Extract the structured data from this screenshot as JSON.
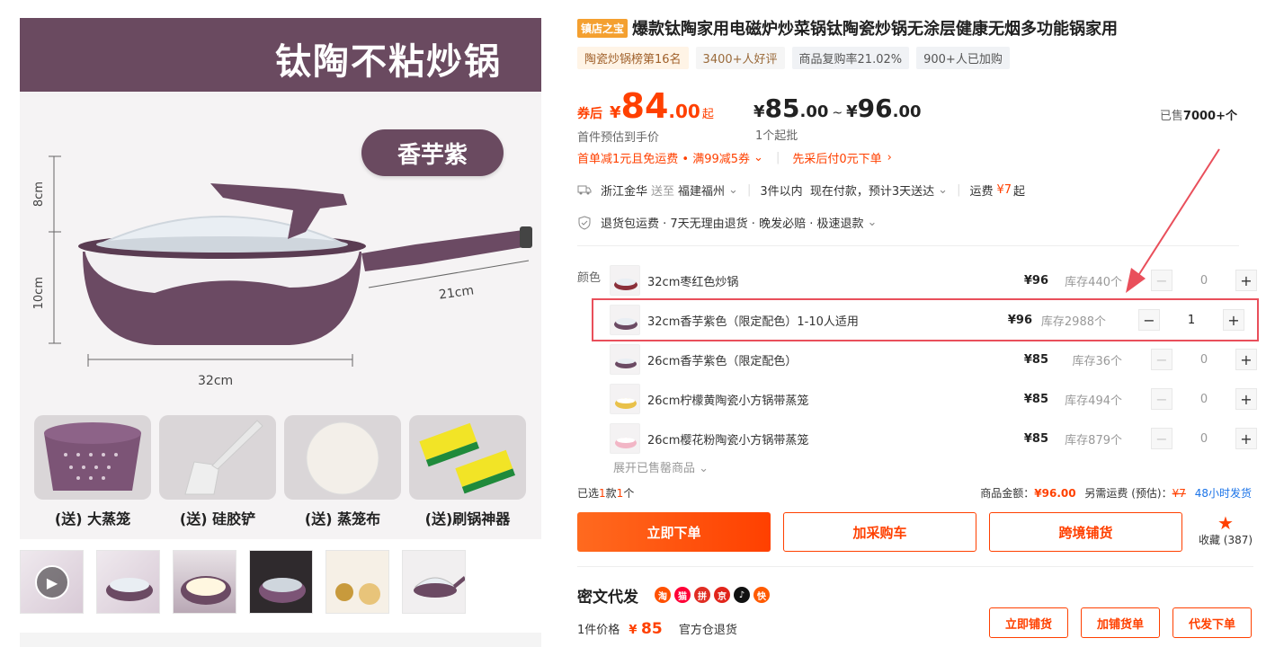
{
  "gallery": {
    "banner_title": "钛陶不粘炒锅",
    "color_pill": "香芋紫",
    "dims": {
      "height_top": "8cm",
      "height_bottom": "10cm",
      "handle": "21cm",
      "diameter": "32cm"
    },
    "accessories": [
      {
        "label": "(送) 大蒸笼",
        "icon": "steamer-basket-icon"
      },
      {
        "label": "(送) 硅胶铲",
        "icon": "spatula-icon"
      },
      {
        "label": "(送) 蒸笼布",
        "icon": "steamer-cloth-icon"
      },
      {
        "label": "(送)刷锅神器",
        "icon": "sponge-icon"
      }
    ],
    "thumb_count": 6
  },
  "product": {
    "store_badge": "镇店之宝",
    "title": "爆款钛陶家用电磁炉炒菜锅钛陶瓷炒锅无涂层健康无烟多功能锅家用",
    "tags": [
      "陶瓷炒锅榜第16名",
      "3400+人好评",
      "商品复购率21.02%",
      "900+人已加购"
    ]
  },
  "price": {
    "coupon_label": "券后",
    "currency": "¥",
    "main_int": "84",
    "main_dec": ".00",
    "main_suffix": "起",
    "main_sub": "首件预估到手价",
    "range_low_int": "85",
    "range_low_dec": ".00",
    "range_tilde": "~",
    "range_high_int": "96",
    "range_high_dec": ".00",
    "min_order": "1个起批",
    "sold_label": "已售",
    "sold_value": "7000+个"
  },
  "promo": {
    "first_order": "首单减1元且免运费 • 满99减5券",
    "pay_later": "先采后付0元下单"
  },
  "shipping": {
    "from": "浙江金华",
    "to_label": "送至",
    "to": "福建福州",
    "delivery": "3件以内  现在付款，预计3天送达",
    "fee_label": "运费",
    "fee_value": "¥7",
    "fee_suffix": "起"
  },
  "services": "退货包运费 · 7天无理由退货 · 晚发必赔 · 极速退款",
  "sku": {
    "color_label": "颜色",
    "items": [
      {
        "name": "32cm枣红色炒锅",
        "price": "¥96",
        "stock": "库存440个",
        "qty": "0"
      },
      {
        "name": "32cm香芋紫色（限定配色）1-10人适用",
        "price": "¥96",
        "stock": "库存2988个",
        "qty": "1"
      },
      {
        "name": "26cm香芋紫色（限定配色）",
        "price": "¥85",
        "stock": "库存36个",
        "qty": "0"
      },
      {
        "name": "26cm柠檬黄陶瓷小方锅带蒸笼",
        "price": "¥85",
        "stock": "库存494个",
        "qty": "0"
      },
      {
        "name": "26cm樱花粉陶瓷小方锅带蒸笼",
        "price": "¥85",
        "stock": "库存879个",
        "qty": "0"
      }
    ],
    "expand_label": "展开已售罄商品"
  },
  "summary": {
    "selected_prefix": "已选",
    "selected_kinds": "1",
    "selected_mid": "款",
    "selected_count": "1",
    "selected_suffix": "个",
    "amount_label": "商品金额：",
    "amount_value": "¥96.00",
    "ship_label": "另需运费 (预估)：",
    "ship_value": "¥7",
    "dispatch": "48小时发货"
  },
  "actions": {
    "buy_now": "立即下单",
    "add_cart": "加采购车",
    "cross_border": "跨境铺货",
    "fav_label": "收藏 (387)"
  },
  "dropship": {
    "title": "密文代发",
    "platforms": [
      {
        "icon": "taobao-icon",
        "char": "淘",
        "color": "#ff5000"
      },
      {
        "icon": "tmall-icon",
        "char": "猫",
        "color": "#ff0036"
      },
      {
        "icon": "pdd-icon",
        "char": "拼",
        "color": "#e02e24"
      },
      {
        "icon": "jd-icon",
        "char": "京",
        "color": "#e1251b"
      },
      {
        "icon": "douyin-icon",
        "char": "♪",
        "color": "#111111"
      },
      {
        "icon": "kuaishou-icon",
        "char": "快",
        "color": "#ff5a00"
      }
    ],
    "price_label": "1件价格",
    "price_cur": "¥",
    "price_value": "85",
    "return_label": "官方仓退货",
    "btn_list": "立即铺货",
    "btn_add": "加铺货单",
    "btn_order": "代发下单"
  },
  "colors": {
    "accent": "#ff4000",
    "brand_purple": "#6a4a60",
    "highlight": "#e94f5b"
  }
}
